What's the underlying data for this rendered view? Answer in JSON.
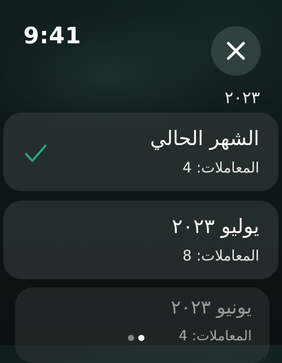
{
  "status_bar": {
    "time": "9:41"
  },
  "header": {
    "year": "٢٠٢٣",
    "close_icon": "close-icon"
  },
  "months": [
    {
      "title": "الشهر الحالي",
      "transactions": "المعاملات: 4",
      "selected": true
    },
    {
      "title": "يوليو ٢٠٢٣",
      "transactions": "المعاملات: 8",
      "selected": false
    },
    {
      "title": "يونيو ٢٠٢٣",
      "transactions": "المعاملات: 4",
      "selected": false
    }
  ],
  "colors": {
    "accent": "#2fa58c",
    "background": "#0d1716"
  },
  "page_indicator": {
    "count": 2,
    "active": 1
  }
}
